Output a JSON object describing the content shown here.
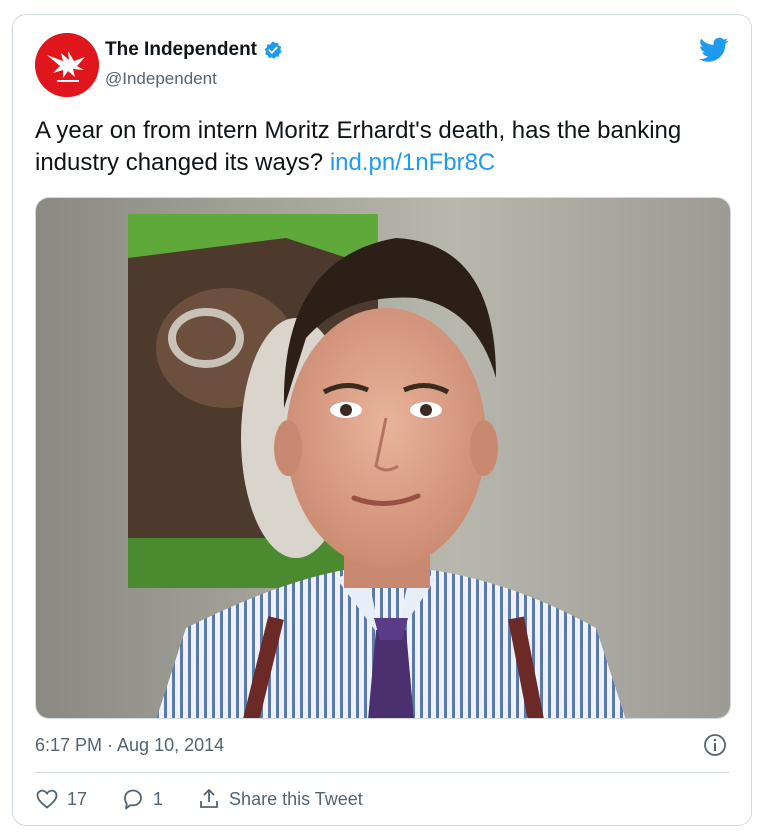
{
  "tweet": {
    "author": {
      "display_name": "The Independent",
      "handle": "@Independent",
      "verified": true,
      "avatar_icon": "eagle-logo-icon",
      "avatar_color": "#e0161c"
    },
    "text": "A year on from intern Moritz Erhardt's death, has the banking industry changed its ways?",
    "link": "ind.pn/1nFbr8C",
    "image_icon": "portrait-photo",
    "timestamp": "6:17 PM · Aug 10, 2014",
    "likes": "17",
    "replies": "1",
    "share_label": "Share this Tweet"
  },
  "colors": {
    "link": "#1d9bf0",
    "muted": "#536471",
    "border": "#cfd9de",
    "twitter_blue": "#1d9bf0"
  }
}
